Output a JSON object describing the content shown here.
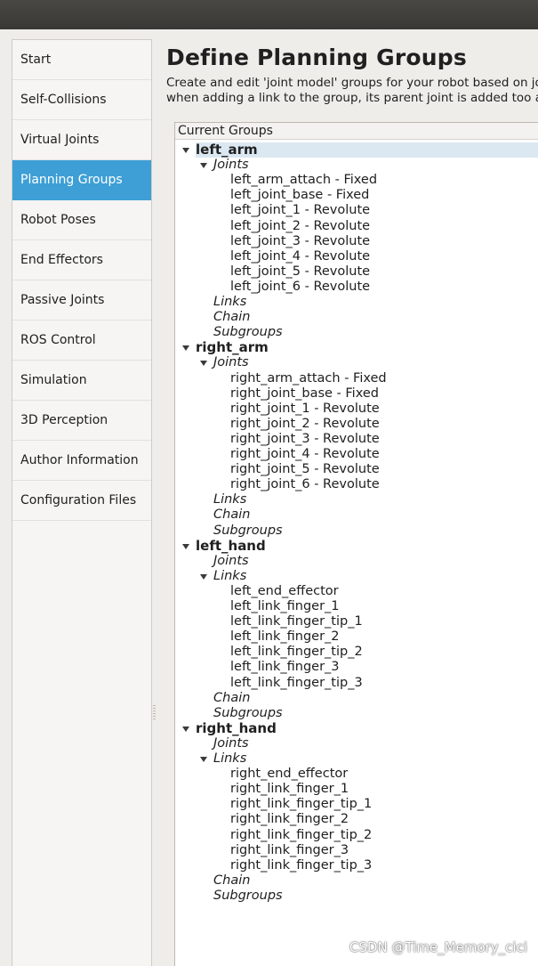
{
  "sidebar": {
    "items": [
      {
        "label": "Start",
        "active": false
      },
      {
        "label": "Self-Collisions",
        "active": false
      },
      {
        "label": "Virtual Joints",
        "active": false
      },
      {
        "label": "Planning Groups",
        "active": true
      },
      {
        "label": "Robot Poses",
        "active": false
      },
      {
        "label": "End Effectors",
        "active": false
      },
      {
        "label": "Passive Joints",
        "active": false
      },
      {
        "label": "ROS Control",
        "active": false
      },
      {
        "label": "Simulation",
        "active": false
      },
      {
        "label": "3D Perception",
        "active": false
      },
      {
        "label": "Author Information",
        "active": false
      },
      {
        "label": "Configuration Files",
        "active": false
      }
    ]
  },
  "main": {
    "title": "Define Planning Groups",
    "description_line1": "Create and edit 'joint model' groups for your robot based on jo",
    "description_line2": "when adding a link to the group, its parent joint is added too a",
    "tree_header": "Current Groups"
  },
  "tree": [
    {
      "name": "left_arm",
      "expanded": true,
      "categories": [
        {
          "label": "Joints",
          "expanded": true,
          "items": [
            "left_arm_attach - Fixed",
            "left_joint_base - Fixed",
            "left_joint_1 - Revolute",
            "left_joint_2 - Revolute",
            "left_joint_3 - Revolute",
            "left_joint_4 - Revolute",
            "left_joint_5 - Revolute",
            "left_joint_6 - Revolute"
          ]
        },
        {
          "label": "Links",
          "expanded": false,
          "items": []
        },
        {
          "label": "Chain",
          "expanded": false,
          "items": []
        },
        {
          "label": "Subgroups",
          "expanded": false,
          "items": []
        }
      ]
    },
    {
      "name": "right_arm",
      "expanded": true,
      "categories": [
        {
          "label": "Joints",
          "expanded": true,
          "items": [
            "right_arm_attach - Fixed",
            "right_joint_base - Fixed",
            "right_joint_1 - Revolute",
            "right_joint_2 - Revolute",
            "right_joint_3 - Revolute",
            "right_joint_4 - Revolute",
            "right_joint_5 - Revolute",
            "right_joint_6 - Revolute"
          ]
        },
        {
          "label": "Links",
          "expanded": false,
          "items": []
        },
        {
          "label": "Chain",
          "expanded": false,
          "items": []
        },
        {
          "label": "Subgroups",
          "expanded": false,
          "items": []
        }
      ]
    },
    {
      "name": "left_hand",
      "expanded": true,
      "categories": [
        {
          "label": "Joints",
          "expanded": false,
          "items": []
        },
        {
          "label": "Links",
          "expanded": true,
          "items": [
            "left_end_effector",
            "left_link_finger_1",
            "left_link_finger_tip_1",
            "left_link_finger_2",
            "left_link_finger_tip_2",
            "left_link_finger_3",
            "left_link_finger_tip_3"
          ]
        },
        {
          "label": "Chain",
          "expanded": false,
          "items": []
        },
        {
          "label": "Subgroups",
          "expanded": false,
          "items": []
        }
      ]
    },
    {
      "name": "right_hand",
      "expanded": true,
      "categories": [
        {
          "label": "Joints",
          "expanded": false,
          "items": []
        },
        {
          "label": "Links",
          "expanded": true,
          "items": [
            "right_end_effector",
            "right_link_finger_1",
            "right_link_finger_tip_1",
            "right_link_finger_2",
            "right_link_finger_tip_2",
            "right_link_finger_3",
            "right_link_finger_tip_3"
          ]
        },
        {
          "label": "Chain",
          "expanded": false,
          "items": []
        },
        {
          "label": "Subgroups",
          "expanded": false,
          "items": []
        }
      ]
    }
  ],
  "watermark": "CSDN @Time_Memory_cici",
  "colors": {
    "accent": "#3d9fd6",
    "selection": "#dbe8f2"
  }
}
